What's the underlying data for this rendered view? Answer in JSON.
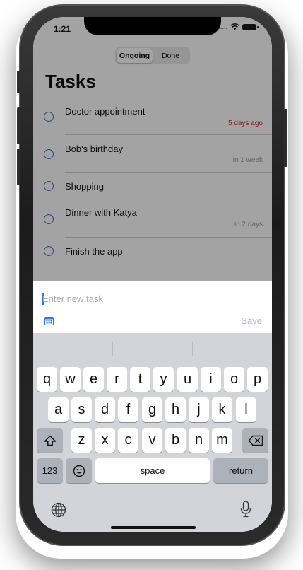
{
  "status_bar": {
    "time": "1:21",
    "signal": "....."
  },
  "tabs": [
    {
      "label": "Ongoing",
      "active": true
    },
    {
      "label": "Done",
      "active": false
    }
  ],
  "page_title": "Tasks",
  "tasks": [
    {
      "title": "Doctor appointment",
      "due": "5 days ago",
      "overdue": true
    },
    {
      "title": "Bob's birthday",
      "due": "in 1 week",
      "overdue": false
    },
    {
      "title": "Shopping",
      "due": "",
      "overdue": false
    },
    {
      "title": "Dinner with Katya",
      "due": "in 2 days",
      "overdue": false
    },
    {
      "title": "Finish the app",
      "due": "",
      "overdue": false
    }
  ],
  "entry": {
    "placeholder": "Enter new task",
    "value": "",
    "save_label": "Save",
    "calendar_icon": "calendar-icon"
  },
  "keyboard": {
    "row1": [
      "q",
      "w",
      "e",
      "r",
      "t",
      "y",
      "u",
      "i",
      "o",
      "p"
    ],
    "row2": [
      "a",
      "s",
      "d",
      "f",
      "g",
      "h",
      "j",
      "k",
      "l"
    ],
    "row3": [
      "z",
      "x",
      "c",
      "v",
      "b",
      "n",
      "m"
    ],
    "numbers_label": "123",
    "space_label": "space",
    "return_label": "return",
    "shift_icon": "shift-icon",
    "delete_icon": "delete-icon",
    "emoji_icon": "emoji-icon",
    "globe_icon": "globe-icon",
    "mic_icon": "microphone-icon"
  },
  "colors": {
    "accent": "#2f76d8",
    "overdue": "#d0252b",
    "keyboard_bg": "#d2d4d9"
  }
}
